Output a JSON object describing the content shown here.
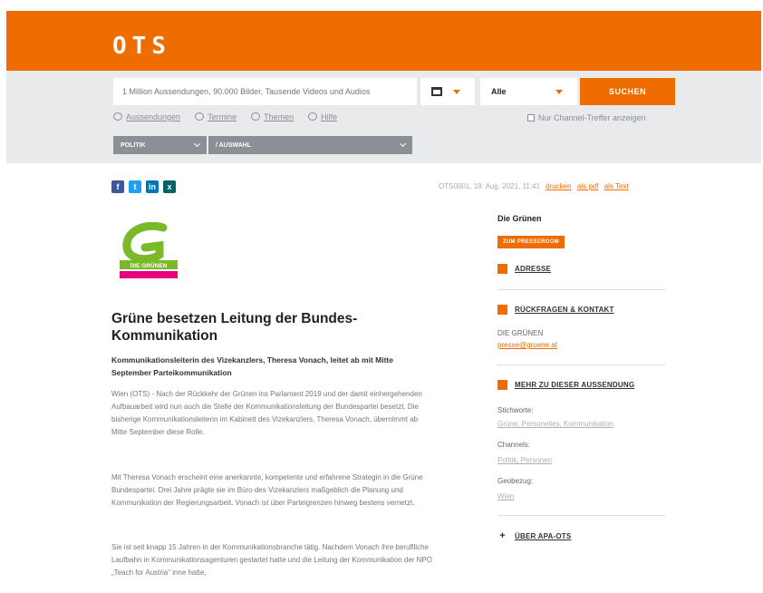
{
  "header": {
    "logo": "OTS"
  },
  "search": {
    "placeholder": "1 Million Aussendungen, 90.000 Bilder, Tausende Videos und Audios",
    "category_selected": "Alle",
    "button_label": "SUCHEN",
    "channel_checkbox_label": "Nur Channel-Treffer anzeigen"
  },
  "subnav": {
    "items": [
      "Aussendungen",
      "Termine",
      "Themen",
      "Hilfe"
    ]
  },
  "filters": {
    "filter1": "POLITIK",
    "filter2": "/ AUSWAHL"
  },
  "share": {
    "facebook": "f",
    "twitter": "t",
    "linkedin": "in",
    "xing": "x"
  },
  "dateline": {
    "text": "OTS0001, 18. Aug. 2021, 11:41",
    "links": [
      "drucken",
      "als pdf",
      "als Text"
    ]
  },
  "org_logo_text": "DIE GRÜNEN",
  "article": {
    "headline": "Grüne besetzen Leitung der Bundes-Kommunikation",
    "lead": "Kommunikationsleiterin des Vizekanzlers, Theresa Vonach, leitet ab mit Mitte September Parteikommunikation",
    "paragraphs": [
      "Wien (OTS) - Nach der Rückkehr der Grünen ins Parlament 2019 und der damit einhergehenden Aufbauarbeit wird nun auch die Stelle der Kommunikationsleitung der Bundespartei besetzt. Die bisherige Kommunikationsleiterin im Kabinett des Vizekanzlers, Theresa Vonach, übernimmt ab Mitte September diese Rolle.",
      "Mit Theresa Vonach erscheint eine anerkannte, kompetente und erfahrene Strategin in die Grüne Bundespartei. Drei Jahre prägte sie im Büro des Vizekanzlers maßgeblich die Planung und Kommunikation der Regierungsarbeit. Vonach ist über Parteigrenzen hinweg bestens vernetzt.",
      "Sie ist seit knapp 15 Jahren in der Kommunikationsbranche tätig. Nachdem Vonach ihre beruflliche Laufbahn in Kommunikationsagenturen gestartet hatte und die Leitung der Kommunikation der NPO „Teach for Austria“ inne hatte,"
    ]
  },
  "sidebar": {
    "org_name": "Die Grünen",
    "press_button": "ZUM PRESSEROOM",
    "sections": {
      "adresse": "ADRESSE",
      "rueckfragen": "RÜCKFRAGEN & KONTAKT",
      "mehr": "MEHR ZU DIESER AUSSENDUNG",
      "ueber": "ÜBER APA-OTS"
    },
    "contact_name": "DIE GRÜNEN",
    "contact_email": "presse@gruene.at",
    "keywords_label": "Stichworte:",
    "keywords_value": "Grüne, Personelles, Kommunikation",
    "channels_label": "Channels:",
    "channels_value": "Politik, Personen",
    "region_label": "Geobezug:",
    "region_value": "Wien"
  },
  "colors": {
    "accent": "#ef6c00",
    "search_bg": "#e9eaec",
    "filter_bg": "#8c9096"
  }
}
